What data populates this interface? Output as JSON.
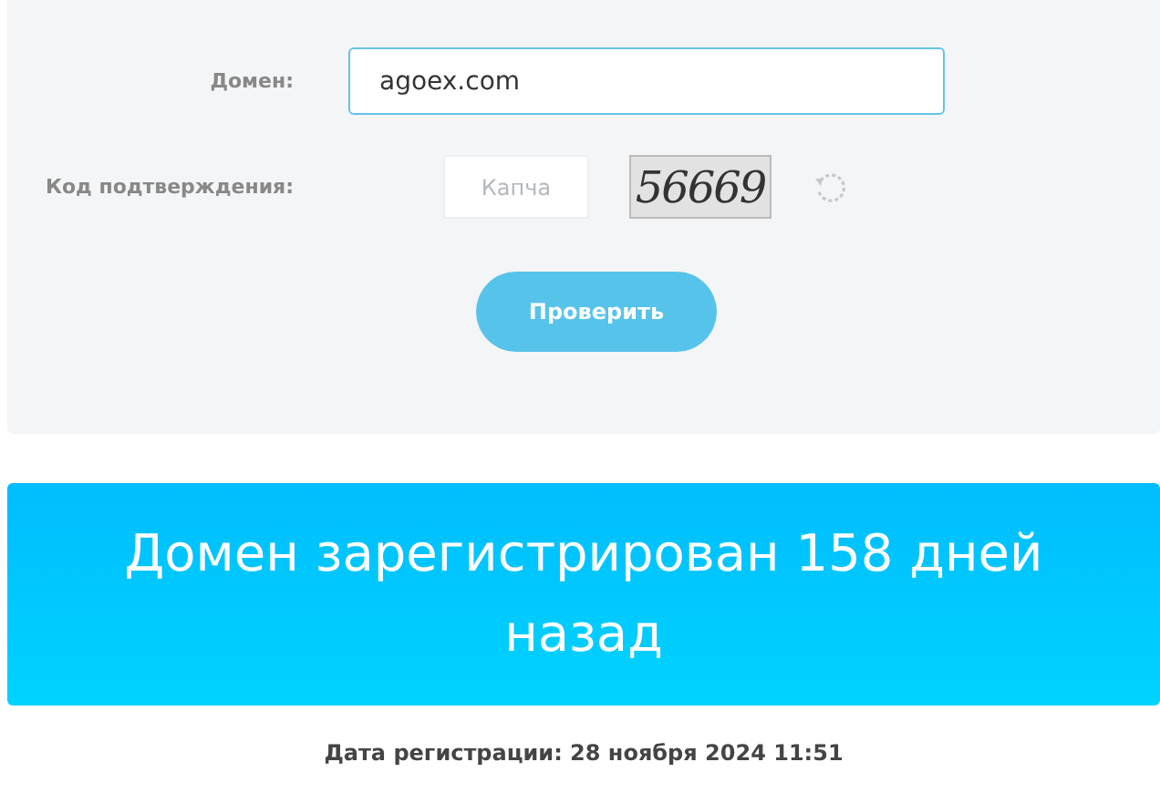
{
  "form": {
    "domain_label": "Домен:",
    "domain_value": "agoex.com",
    "captcha_label": "Код подтверждения:",
    "captcha_placeholder": "Капча",
    "captcha_code": "56669",
    "submit": "Проверить"
  },
  "result": {
    "message": "Домен зарегистрирован 158 дней назад",
    "registration_date": "Дата регистрации: 28 ноября 2024 11:51"
  }
}
